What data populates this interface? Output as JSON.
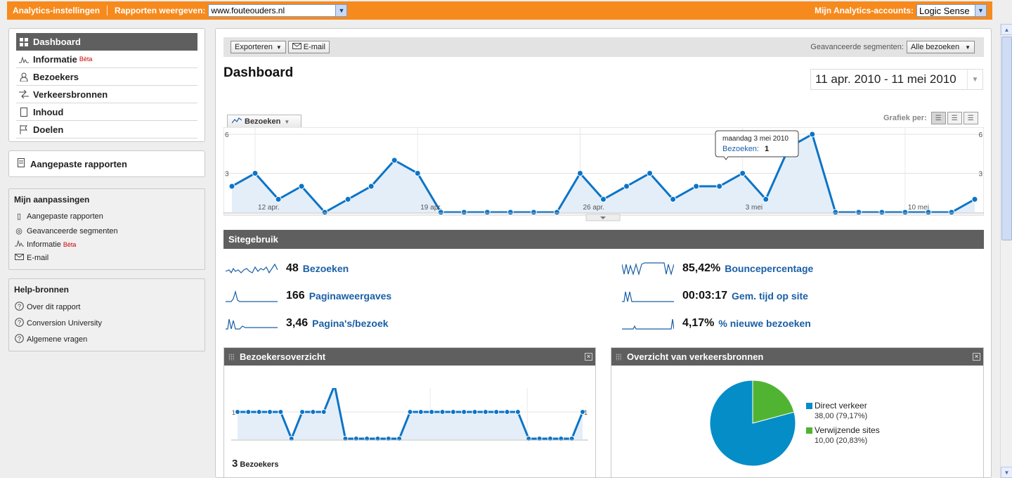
{
  "topbar": {
    "settings": "Analytics-instellingen",
    "reports_label": "Rapporten weergeven:",
    "site": "www.fouteouders.nl",
    "accounts_label": "Mijn Analytics-accounts:",
    "account": "Logic Sense"
  },
  "nav": {
    "items": [
      {
        "label": "Dashboard",
        "icon": "grid-icon",
        "active": true
      },
      {
        "label": "Informatie",
        "icon": "sparkline-icon",
        "badge": "Bèta"
      },
      {
        "label": "Bezoekers",
        "icon": "person-icon"
      },
      {
        "label": "Verkeersbronnen",
        "icon": "arrows-icon"
      },
      {
        "label": "Inhoud",
        "icon": "page-icon"
      },
      {
        "label": "Doelen",
        "icon": "flag-icon"
      }
    ],
    "custom_reports": "Aangepaste rapporten"
  },
  "mine": {
    "title": "Mijn aanpassingen",
    "items": [
      {
        "label": "Aangepaste rapporten",
        "icon": "document-icon"
      },
      {
        "label": "Geavanceerde segmenten",
        "icon": "target-icon"
      },
      {
        "label": "Informatie",
        "icon": "sparkline-icon",
        "badge": "Bèta"
      },
      {
        "label": "E-mail",
        "icon": "envelope-icon"
      }
    ]
  },
  "help": {
    "title": "Help-bronnen",
    "items": [
      {
        "label": "Over dit rapport",
        "icon": "question-icon"
      },
      {
        "label": "Conversion University",
        "icon": "question-icon"
      },
      {
        "label": "Algemene vragen",
        "icon": "question-icon"
      }
    ]
  },
  "toolbar": {
    "export": "Exporteren",
    "email": "E-mail",
    "segments_label": "Geavanceerde segmenten:",
    "segment": "Alle bezoeken"
  },
  "page": {
    "title": "Dashboard",
    "date_range": "11 apr. 2010 - 11 mei 2010",
    "metric": "Bezoeken",
    "graph_per": "Grafiek per:"
  },
  "tooltip": {
    "date": "maandag 3 mei 2010",
    "metric": "Bezoeken:",
    "value": "1"
  },
  "colors": {
    "accent": "#f78a1d",
    "line": "#0b74c7",
    "fill": "#e4eef8",
    "pie_direct": "#058dc7",
    "pie_ref": "#50b432"
  },
  "chart_data": [
    {
      "type": "line",
      "name": "main",
      "series": [
        {
          "name": "Bezoeken",
          "values": [
            2,
            3,
            1,
            2,
            0,
            1,
            2,
            4,
            3,
            0,
            0,
            0,
            0,
            0,
            0,
            3,
            1,
            2,
            3,
            1,
            2,
            2,
            3,
            1,
            5,
            6,
            0,
            0,
            0,
            0,
            0,
            0,
            1
          ]
        }
      ],
      "x_tick_labels": [
        "12 apr.",
        "19 apr.",
        "26 apr.",
        "3 mei",
        "10 mei"
      ],
      "y_ticks": [
        "3",
        "6"
      ],
      "ylim": [
        0,
        6
      ]
    },
    {
      "type": "line",
      "name": "bezoekersoverzicht",
      "series": [
        {
          "name": "Bezoekers",
          "values": [
            1,
            1,
            1,
            1,
            1,
            0,
            1,
            1,
            1,
            2,
            0,
            0,
            0,
            0,
            0,
            0,
            1,
            1,
            1,
            1,
            1,
            1,
            1,
            1,
            1,
            1,
            1,
            0,
            0,
            0,
            0,
            0,
            1
          ]
        }
      ],
      "y_ticks": [
        "1",
        "2"
      ],
      "ylim": [
        0,
        2
      ]
    },
    {
      "type": "pie",
      "name": "verkeersbronnen",
      "slices": [
        {
          "label": "Direct verkeer",
          "value": "38,00 (79,17%)",
          "pct": 79.17
        },
        {
          "label": "Verwijzende sites",
          "value": "10,00 (20,83%)",
          "pct": 20.83
        }
      ]
    }
  ],
  "sitegebruik": {
    "title": "Sitegebruik",
    "stats": [
      {
        "value": "48",
        "label": "Bezoeken"
      },
      {
        "value": "166",
        "label": "Paginaweergaves"
      },
      {
        "value": "3,46",
        "label": "Pagina's/bezoek"
      },
      {
        "value": "85,42%",
        "label": "Bouncepercentage"
      },
      {
        "value": "00:03:17",
        "label": "Gem. tijd op site"
      },
      {
        "value": "4,17%",
        "label": "% nieuwe bezoeken"
      }
    ]
  },
  "boxes": {
    "visitors_title": "Bezoekersoverzicht",
    "visitors_count": "3",
    "visitors_label": "Bezoekers",
    "traffic_title": "Overzicht van verkeersbronnen"
  }
}
